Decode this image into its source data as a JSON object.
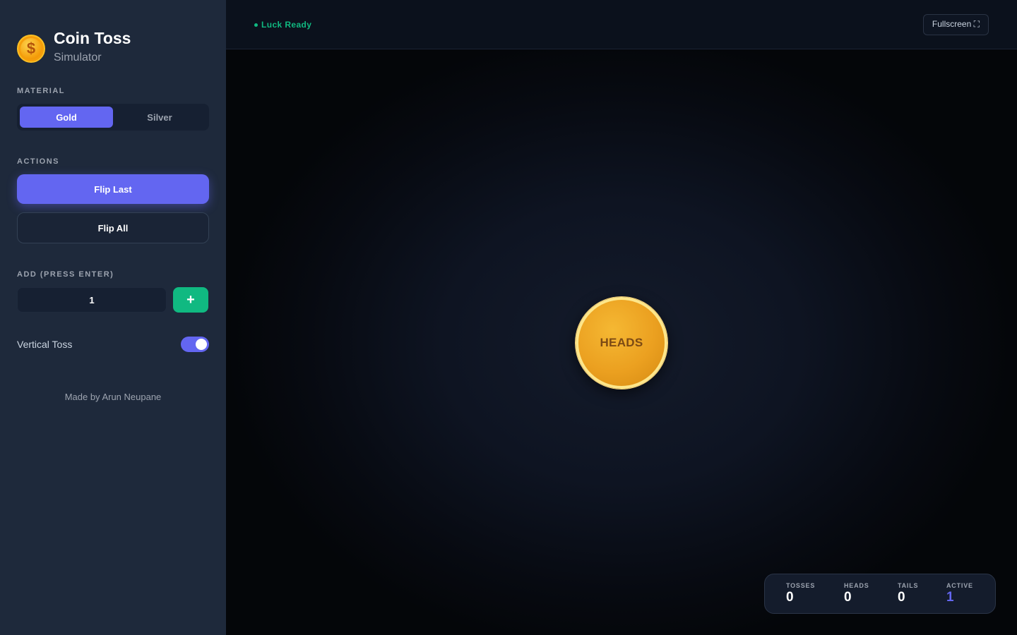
{
  "brand": {
    "title": "Coin Toss",
    "subtitle": "Simulator",
    "icon": "dollar-coin-icon",
    "icon_glyph": "$"
  },
  "material": {
    "label": "MATERIAL",
    "options": [
      "Gold",
      "Silver"
    ],
    "selected": "Gold"
  },
  "actions": {
    "label": "ACTIONS",
    "flip_last": "Flip Last",
    "flip_all": "Flip All"
  },
  "add": {
    "label": "ADD (PRESS ENTER)",
    "value": "1",
    "button_glyph": "+"
  },
  "vertical_toss": {
    "label": "Vertical Toss",
    "enabled": true
  },
  "credit": "Made by Arun Neupane",
  "topbar": {
    "status": "Luck Ready",
    "fullscreen": "Fullscreen ⛶"
  },
  "coin": {
    "face": "HEADS"
  },
  "stats": {
    "tosses": {
      "label": "TOSSES",
      "value": "0"
    },
    "heads": {
      "label": "HEADS",
      "value": "0"
    },
    "tails": {
      "label": "TAILS",
      "value": "0"
    },
    "active": {
      "label": "ACTIVE",
      "value": "1"
    }
  },
  "colors": {
    "accent": "#6366f1",
    "success": "#10b981",
    "coin_gold": "#eba020",
    "sidebar_bg": "#1e293b"
  }
}
